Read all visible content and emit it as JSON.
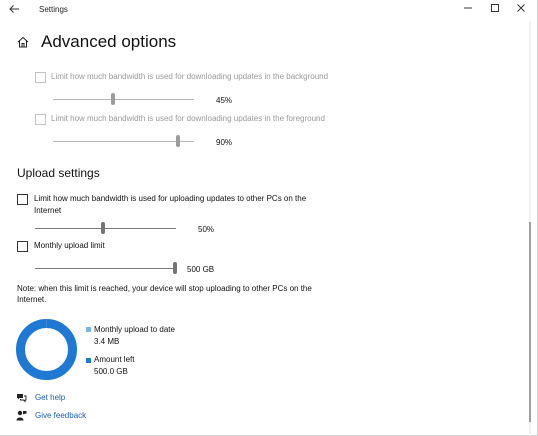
{
  "window": {
    "title": "Settings"
  },
  "page": {
    "title": "Advanced options"
  },
  "download": {
    "background": {
      "label": "Limit how much bandwidth is used for downloading updates in the background",
      "value": "45%",
      "fraction": 0.45
    },
    "foreground": {
      "label": "Limit how much bandwidth is used for downloading updates in the foreground",
      "value": "90%",
      "fraction": 0.9
    }
  },
  "upload": {
    "section_title": "Upload settings",
    "bandwidth": {
      "label_line1": "Limit how much bandwidth is used for uploading updates to other PCs on the",
      "label_line2": "Internet",
      "value": "50%",
      "fraction": 0.5
    },
    "monthly": {
      "label": "Monthly upload limit",
      "value": "500 GB",
      "fraction": 1.0
    },
    "note_line1": "Note: when this limit is reached, your device will stop uploading to other PCs on the",
    "note_line2": "Internet."
  },
  "usage": {
    "uploaded_label": "Monthly upload to date",
    "uploaded_value": "3.4 MB",
    "left_label": "Amount left",
    "left_value": "500.0 GB",
    "uploaded_color": "#79b4e6",
    "left_color": "#1f78d1"
  },
  "links": {
    "help": "Get help",
    "feedback": "Give feedback"
  }
}
